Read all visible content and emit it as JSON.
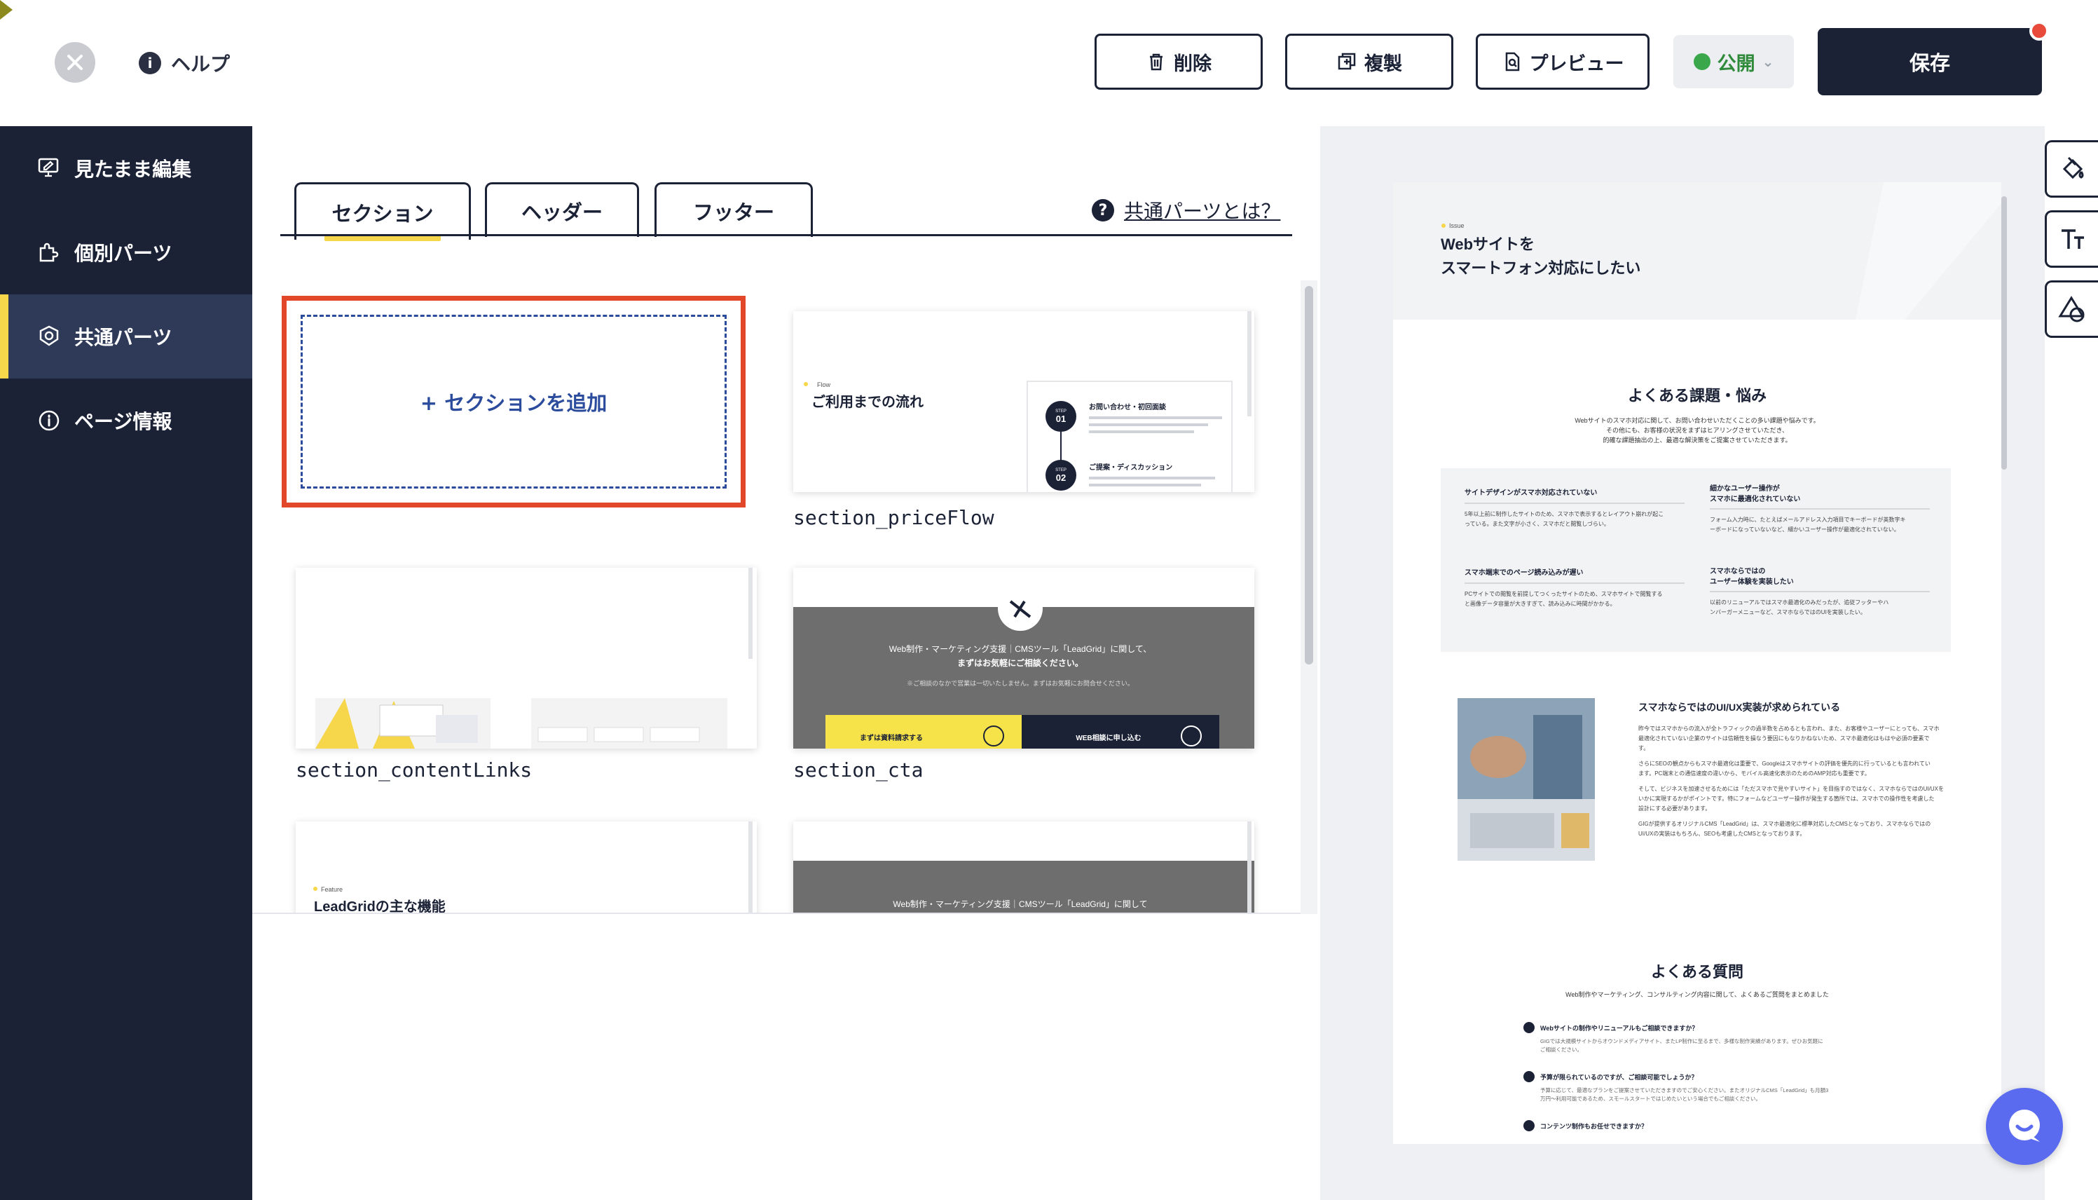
{
  "topbar": {
    "help_label": "ヘルプ",
    "delete_label": "削除",
    "duplicate_label": "複製",
    "preview_label": "プレビュー",
    "publish_label": "公開",
    "save_label": "保存"
  },
  "sidebar": {
    "items": [
      {
        "label": "見たまま編集",
        "icon": "monitor-edit-icon"
      },
      {
        "label": "個別パーツ",
        "icon": "puzzle-icon"
      },
      {
        "label": "共通パーツ",
        "icon": "shared-parts-icon"
      },
      {
        "label": "ページ情報",
        "icon": "info-icon"
      }
    ]
  },
  "tabs": [
    {
      "label": "セクション",
      "active": true
    },
    {
      "label": "ヘッダー",
      "active": false
    },
    {
      "label": "フッター",
      "active": false
    }
  ],
  "whatis_label": "共通パーツとは？",
  "add_section_label": "+ セクションを追加",
  "cards": [
    {
      "name": "section_priceFlow"
    },
    {
      "name": "section_contentLinks"
    },
    {
      "name": "section_cta"
    }
  ],
  "thumbs": {
    "priceflow": {
      "eyebrow": "Flow",
      "title": "ご利用までの流れ",
      "step1_label": "STEP",
      "step1_num": "01",
      "step1_title": "お問い合わせ・初回面談",
      "step2_label": "STEP",
      "step2_num": "02",
      "step2_title": "ご提案・ディスカッション"
    },
    "cta": {
      "line1": "Web制作・マーケティング支援｜CMSツール「LeadGrid」に関して、",
      "line2": "まずはお気軽にご相談ください。",
      "note": "※ご相談のなかで営業は一切いたしません。まずはお気軽にお問合せください。",
      "btn_doc": "まずは資料請求する",
      "btn_web": "WEB相談に申し込む"
    },
    "feature": {
      "eyebrow": "Feature",
      "title": "LeadGridの主な機能"
    },
    "cta2": {
      "line1": "Web制作・マーケティング支援｜CMSツール「LeadGrid」に関して"
    }
  },
  "preview": {
    "issue_eyebrow": "Issue",
    "hero_line1": "Webサイトを",
    "hero_line2": "スマートフォン対応にしたい",
    "problems_title": "よくある課題・悩み",
    "problems_sub1": "Webサイトのスマホ対応に関して、お問い合わせいただくことの多い課題や悩みです。",
    "problems_sub2": "その他にも、お客様の状況をまずはヒアリングさせていただき、",
    "problems_sub3": "的確な課題抽出の上、最適な解決策をご提案させていただきます。",
    "problem_items": [
      {
        "title": "サイトデザインがスマホ対応されていない",
        "body1": "5年以上前に制作したサイトのため、スマホで表示するとレイアウト崩れが起こ",
        "body2": "っている。また文字が小さく、スマホだと閲覧しづらい。"
      },
      {
        "title1": "細かなユーザー操作が",
        "title2": "スマホに最適化されていない",
        "body1": "フォーム入力時に、たとえばメールアドレス入力項目でキーボードが英数字キ",
        "body2": "ーボードになっていないなど、細かいユーザー操作が最適化されていない。"
      },
      {
        "title": "スマホ端末でのページ読み込みが遅い",
        "body1": "PCサイトでの閲覧を前提してつくったサイトのため、スマホサイトで閲覧する",
        "body2": "と画像データ容量が大きすぎて、読み込みに時間がかかる。"
      },
      {
        "title1": "スマホならではの",
        "title2": "ユーザー体験を実装したい",
        "body1": "以前のリニューアルではスマホ最適化のみだったが、追従フッターやハ",
        "body2": "ンバーガーメニューなど、スマホならではのUIを実装したい。"
      }
    ],
    "uiux_title": "スマホならではのUI/UX実装が求められている",
    "uiux_p1a": "昨今ではスマホからの流入が全トラフィックの過半数を占めるとも言われ、また、お客様やユーザーにとっても、スマホ",
    "uiux_p1b": "最適化されていない企業のサイトは信頼性を損なう要因にもなりかねないため、スマホ最適化はもはや必須の要素で",
    "uiux_p1c": "す。",
    "uiux_p2a": "さらにSEOの観点からもスマホ最適化は重要で、Googleはスマホサイトの評価を優先的に行っているとも言われてい",
    "uiux_p2b": "ます。PC端末との通信速度の違いから、モバイル高速化表示のためのAMP対応も重要です。",
    "uiux_p3a": "そして、ビジネスを加速させるためには「ただスマホで見やすいサイト」を目指すのではなく、スマホならではのUI/UXを",
    "uiux_p3b": "いかに実現するかがポイントです。特にフォームなどユーザー操作が発生する箇所では、スマホでの操作性を考慮した",
    "uiux_p3c": "設計にする必要があります。",
    "uiux_p4a": "GIGが提供するオリジナルCMS「LeadGrid」は、スマホ最適化に標準対応したCMSとなっており、スマホならではの",
    "uiux_p4b": "UI/UXの実装はもちろん、SEOも考慮したCMSとなっております。",
    "faq_title": "よくある質問",
    "faq_sub": "Web制作やマーケティング、コンサルティング内容に関して、よくあるご質問をまとめました",
    "faq_items": [
      {
        "q": "Webサイトの制作やリニューアルもご相談できますか？",
        "a1": "GIGでは大規模サイトからオウンドメディアサイト、またLP制作に至るまで、多様な制作実績があります。ぜひお気軽に",
        "a2": "ご相談ください。"
      },
      {
        "q": "予算が限られているのですが、ご相談可能でしょうか？",
        "a1": "予算に応じて、最適なプランをご提案させていただきますのでご安心ください。またオリジナルCMS「LeadGrid」も月額3",
        "a2": "万円〜利用可能であるため、スモールスタートではじめたいという場合でもご相談ください。"
      },
      {
        "q": "コンテンツ制作もお任せできますか？"
      }
    ]
  },
  "colors": {
    "navy": "#1b2236",
    "accent_yellow": "#f6d64a",
    "highlight_red": "#e2472a",
    "add_blue": "#2b4b9c",
    "publish_green": "#3aa84a",
    "chat_blue": "#5b6bf0"
  }
}
